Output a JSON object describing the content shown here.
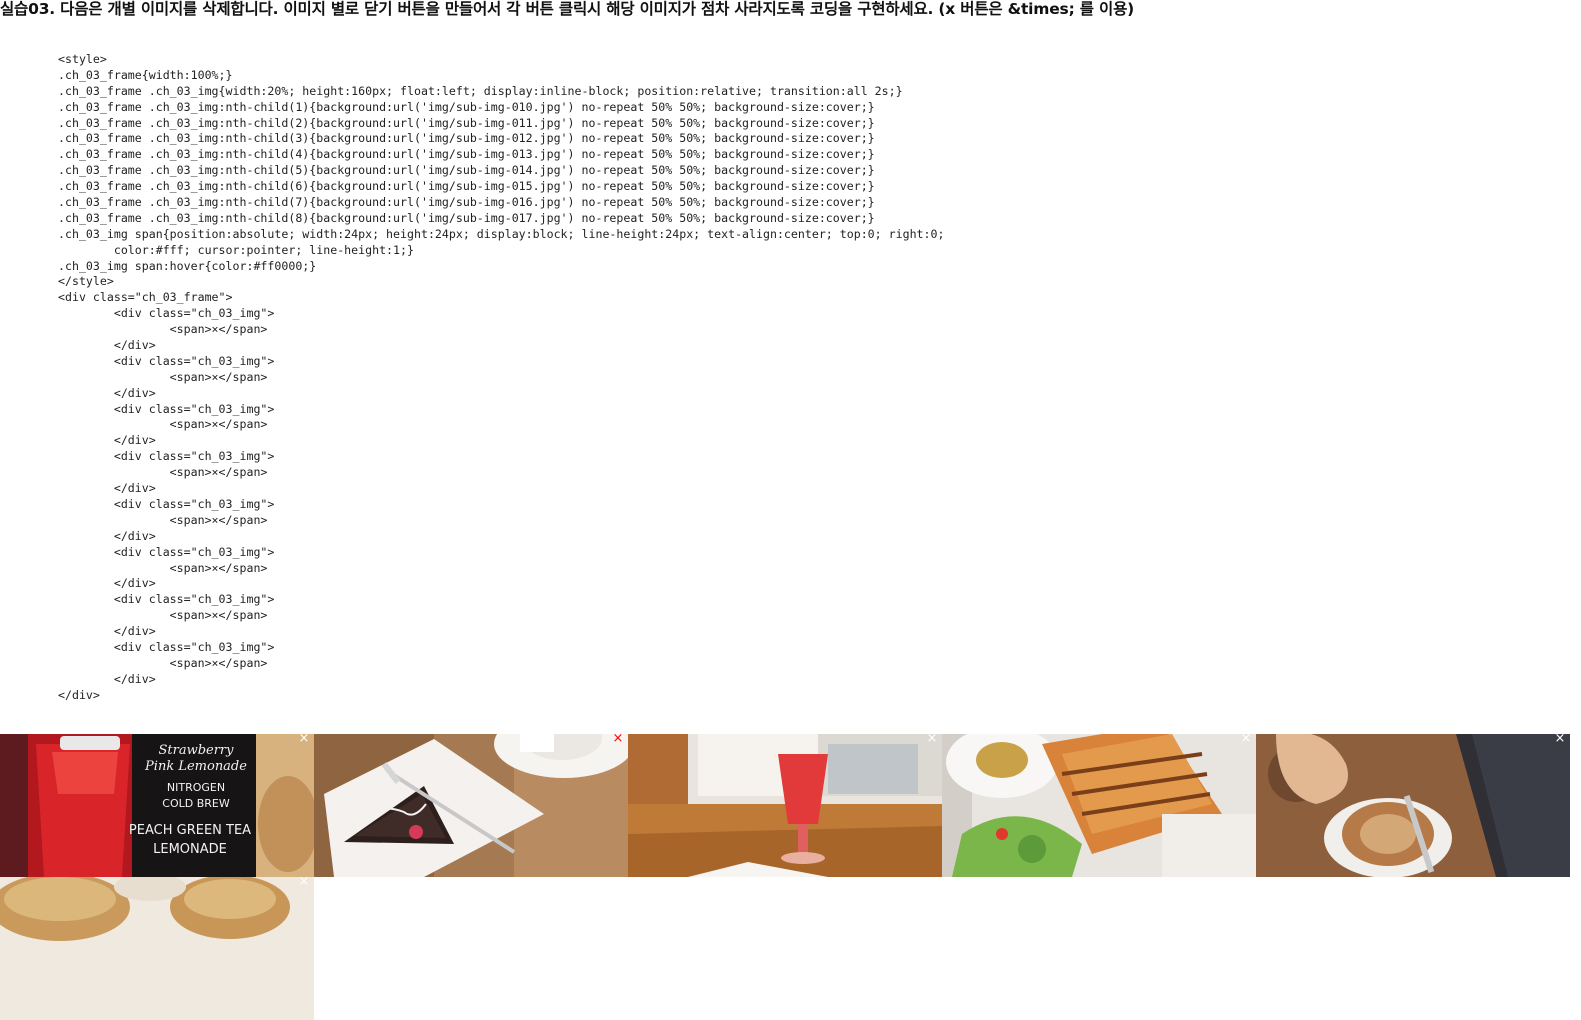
{
  "task": {
    "title": "실습03. 다음은 개별 이미지를 삭제합니다. 이미지 별로 닫기 버튼을 만들어서 각 버튼 클릭시 해당 이미지가 점차 사라지도록 코딩을 구현하세요. (x 버튼은 &times; 를 이용)"
  },
  "code_lines": [
    "<style>",
    ".ch_03_frame{width:100%;}",
    ".ch_03_frame .ch_03_img{width:20%; height:160px; float:left; display:inline-block; position:relative; transition:all 2s;}",
    ".ch_03_frame .ch_03_img:nth-child(1){background:url('img/sub-img-010.jpg') no-repeat 50% 50%; background-size:cover;}",
    ".ch_03_frame .ch_03_img:nth-child(2){background:url('img/sub-img-011.jpg') no-repeat 50% 50%; background-size:cover;}",
    ".ch_03_frame .ch_03_img:nth-child(3){background:url('img/sub-img-012.jpg') no-repeat 50% 50%; background-size:cover;}",
    ".ch_03_frame .ch_03_img:nth-child(4){background:url('img/sub-img-013.jpg') no-repeat 50% 50%; background-size:cover;}",
    ".ch_03_frame .ch_03_img:nth-child(5){background:url('img/sub-img-014.jpg') no-repeat 50% 50%; background-size:cover;}",
    ".ch_03_frame .ch_03_img:nth-child(6){background:url('img/sub-img-015.jpg') no-repeat 50% 50%; background-size:cover;}",
    ".ch_03_frame .ch_03_img:nth-child(7){background:url('img/sub-img-016.jpg') no-repeat 50% 50%; background-size:cover;}",
    ".ch_03_frame .ch_03_img:nth-child(8){background:url('img/sub-img-017.jpg') no-repeat 50% 50%; background-size:cover;}",
    ".ch_03_img span{position:absolute; width:24px; height:24px; display:block; line-height:24px; text-align:center; top:0; right:0;",
    "        color:#fff; cursor:pointer; line-height:1;}",
    ".ch_03_img span:hover{color:#ff0000;}",
    "</style>",
    "<div class=\"ch_03_frame\">",
    "        <div class=\"ch_03_img\">",
    "                <span>×</span>",
    "        </div>",
    "        <div class=\"ch_03_img\">",
    "                <span>×</span>",
    "        </div>",
    "        <div class=\"ch_03_img\">",
    "                <span>×</span>",
    "        </div>",
    "        <div class=\"ch_03_img\">",
    "                <span>×</span>",
    "        </div>",
    "        <div class=\"ch_03_img\">",
    "                <span>×</span>",
    "        </div>",
    "        <div class=\"ch_03_img\">",
    "                <span>×</span>",
    "        </div>",
    "        <div class=\"ch_03_img\">",
    "                <span>×</span>",
    "        </div>",
    "        <div class=\"ch_03_img\">",
    "                <span>×</span>",
    "        </div>",
    "</div>"
  ],
  "gallery": {
    "close_symbol": "×",
    "hover_color": "#ff0000",
    "images": [
      {
        "subject": "strawberry-lemonade-chalkboard",
        "close_color": "#ffffff",
        "sign_lines": [
          "Strawberry",
          "Pink Lemonade",
          "NITROGEN",
          "COLD BREW",
          "PEACH GREEN TEA",
          "LEMONADE"
        ]
      },
      {
        "subject": "chocolate-cake-slice",
        "close_color": "#ff0000"
      },
      {
        "subject": "red-soda-glass-cafe-table",
        "close_color": "#ffffff"
      },
      {
        "subject": "panini-with-salad",
        "close_color": "#ffffff"
      },
      {
        "subject": "latte-and-book",
        "close_color": "#ffffff"
      },
      {
        "subject": "scones",
        "close_color": "#ffffff"
      }
    ]
  }
}
